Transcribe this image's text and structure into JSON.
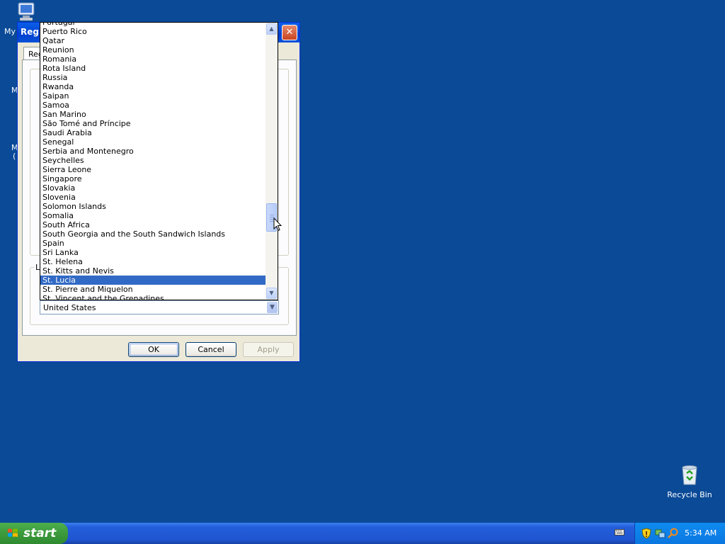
{
  "desktop": {
    "my_computer_partial": "My",
    "partial_left_1": "M",
    "partial_left_2": "M",
    "partial_left_3": "(",
    "recycle_bin_label": "Recycle Bin"
  },
  "dialog": {
    "title_partial": "Regi",
    "tab_partial": "Reg",
    "group_label_partial": "L",
    "current_selection": "United States",
    "buttons": {
      "ok": "OK",
      "cancel": "Cancel",
      "apply": "Apply"
    }
  },
  "dropdown": {
    "items": [
      "Portugal",
      "Puerto Rico",
      "Qatar",
      "Reunion",
      "Romania",
      "Rota Island",
      "Russia",
      "Rwanda",
      "Saipan",
      "Samoa",
      "San Marino",
      "São Tomé and Príncipe",
      "Saudi Arabia",
      "Senegal",
      "Serbia and Montenegro",
      "Seychelles",
      "Sierra Leone",
      "Singapore",
      "Slovakia",
      "Slovenia",
      "Solomon Islands",
      "Somalia",
      "South Africa",
      "South Georgia and the South Sandwich Islands",
      "Spain",
      "Sri Lanka",
      "St. Helena",
      "St. Kitts and Nevis",
      "St. Lucia",
      "St. Pierre and Miquelon",
      "St. Vincent and the Grenadines"
    ],
    "selected": "St. Lucia"
  },
  "taskbar": {
    "start_label": "start",
    "clock": "5:34 AM"
  }
}
